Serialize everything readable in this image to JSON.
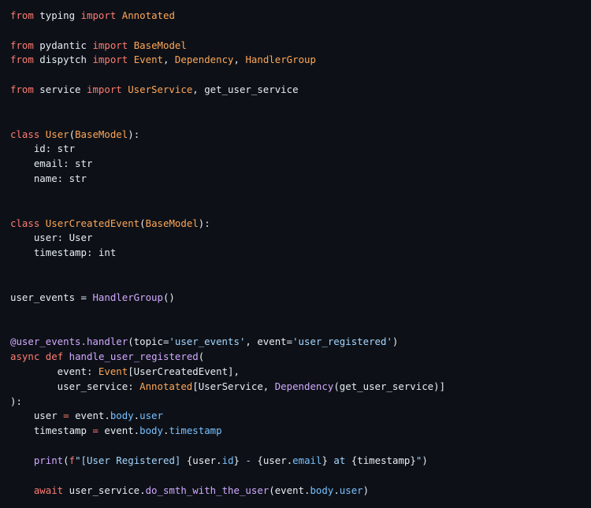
{
  "editor": {
    "language": "python",
    "theme_colors": {
      "background": "#0d1117",
      "text": "#e6edf3",
      "keyword": "#ff7b72",
      "class_name": "#ffa657",
      "function_name": "#d2a8ff",
      "string": "#a5d6ff",
      "attribute": "#79c0ff"
    },
    "lines": [
      [
        {
          "t": "kw",
          "v": "from"
        },
        {
          "t": "txt",
          "v": " typing "
        },
        {
          "t": "kw",
          "v": "import"
        },
        {
          "t": "txt",
          "v": " "
        },
        {
          "t": "cls",
          "v": "Annotated"
        }
      ],
      [],
      [
        {
          "t": "kw",
          "v": "from"
        },
        {
          "t": "txt",
          "v": " pydantic "
        },
        {
          "t": "kw",
          "v": "import"
        },
        {
          "t": "txt",
          "v": " "
        },
        {
          "t": "cls",
          "v": "BaseModel"
        }
      ],
      [
        {
          "t": "kw",
          "v": "from"
        },
        {
          "t": "txt",
          "v": " dispytch "
        },
        {
          "t": "kw",
          "v": "import"
        },
        {
          "t": "txt",
          "v": " "
        },
        {
          "t": "cls",
          "v": "Event"
        },
        {
          "t": "txt",
          "v": ", "
        },
        {
          "t": "cls",
          "v": "Dependency"
        },
        {
          "t": "txt",
          "v": ", "
        },
        {
          "t": "cls",
          "v": "HandlerGroup"
        }
      ],
      [],
      [
        {
          "t": "kw",
          "v": "from"
        },
        {
          "t": "txt",
          "v": " service "
        },
        {
          "t": "kw",
          "v": "import"
        },
        {
          "t": "txt",
          "v": " "
        },
        {
          "t": "cls",
          "v": "UserService"
        },
        {
          "t": "txt",
          "v": ", get_user_service"
        }
      ],
      [],
      [],
      [
        {
          "t": "kw",
          "v": "class"
        },
        {
          "t": "txt",
          "v": " "
        },
        {
          "t": "cls",
          "v": "User"
        },
        {
          "t": "txt",
          "v": "("
        },
        {
          "t": "cls",
          "v": "BaseModel"
        },
        {
          "t": "txt",
          "v": "):"
        }
      ],
      [
        {
          "t": "txt",
          "v": "    id: str"
        }
      ],
      [
        {
          "t": "txt",
          "v": "    email: str"
        }
      ],
      [
        {
          "t": "txt",
          "v": "    name: str"
        }
      ],
      [],
      [],
      [
        {
          "t": "kw",
          "v": "class"
        },
        {
          "t": "txt",
          "v": " "
        },
        {
          "t": "cls",
          "v": "UserCreatedEvent"
        },
        {
          "t": "txt",
          "v": "("
        },
        {
          "t": "cls",
          "v": "BaseModel"
        },
        {
          "t": "txt",
          "v": "):"
        }
      ],
      [
        {
          "t": "txt",
          "v": "    user: User"
        }
      ],
      [
        {
          "t": "txt",
          "v": "    timestamp: int"
        }
      ],
      [],
      [],
      [
        {
          "t": "txt",
          "v": "user_events = "
        },
        {
          "t": "fn",
          "v": "HandlerGroup"
        },
        {
          "t": "txt",
          "v": "()"
        }
      ],
      [],
      [],
      [
        {
          "t": "fn",
          "v": "@user_events.handler"
        },
        {
          "t": "txt",
          "v": "(topic="
        },
        {
          "t": "str",
          "v": "'user_events'"
        },
        {
          "t": "txt",
          "v": ", event="
        },
        {
          "t": "str",
          "v": "'user_registered'"
        },
        {
          "t": "txt",
          "v": ")"
        }
      ],
      [
        {
          "t": "kw",
          "v": "async"
        },
        {
          "t": "txt",
          "v": " "
        },
        {
          "t": "kw",
          "v": "def"
        },
        {
          "t": "txt",
          "v": " "
        },
        {
          "t": "fn",
          "v": "handle_user_registered"
        },
        {
          "t": "txt",
          "v": "("
        }
      ],
      [
        {
          "t": "txt",
          "v": "        event: "
        },
        {
          "t": "cls",
          "v": "Event"
        },
        {
          "t": "txt",
          "v": "[UserCreatedEvent],"
        }
      ],
      [
        {
          "t": "txt",
          "v": "        user_service: "
        },
        {
          "t": "cls",
          "v": "Annotated"
        },
        {
          "t": "txt",
          "v": "[UserService, "
        },
        {
          "t": "fn",
          "v": "Dependency"
        },
        {
          "t": "txt",
          "v": "(get_user_service)]"
        }
      ],
      [
        {
          "t": "txt",
          "v": "):"
        }
      ],
      [
        {
          "t": "txt",
          "v": "    user "
        },
        {
          "t": "kw",
          "v": "="
        },
        {
          "t": "txt",
          "v": " event."
        },
        {
          "t": "attr",
          "v": "body"
        },
        {
          "t": "txt",
          "v": "."
        },
        {
          "t": "attr",
          "v": "user"
        }
      ],
      [
        {
          "t": "txt",
          "v": "    timestamp "
        },
        {
          "t": "kw",
          "v": "="
        },
        {
          "t": "txt",
          "v": " event."
        },
        {
          "t": "attr",
          "v": "body"
        },
        {
          "t": "txt",
          "v": "."
        },
        {
          "t": "attr",
          "v": "timestamp"
        }
      ],
      [],
      [
        {
          "t": "txt",
          "v": "    "
        },
        {
          "t": "fn",
          "v": "print"
        },
        {
          "t": "txt",
          "v": "("
        },
        {
          "t": "kw",
          "v": "f"
        },
        {
          "t": "str",
          "v": "\"[User Registered] "
        },
        {
          "t": "txt",
          "v": "{user."
        },
        {
          "t": "attr",
          "v": "id"
        },
        {
          "t": "txt",
          "v": "}"
        },
        {
          "t": "str",
          "v": " - "
        },
        {
          "t": "txt",
          "v": "{user."
        },
        {
          "t": "attr",
          "v": "email"
        },
        {
          "t": "txt",
          "v": "}"
        },
        {
          "t": "str",
          "v": " at "
        },
        {
          "t": "txt",
          "v": "{timestamp}"
        },
        {
          "t": "str",
          "v": "\""
        },
        {
          "t": "txt",
          "v": ")"
        }
      ],
      [],
      [
        {
          "t": "txt",
          "v": "    "
        },
        {
          "t": "kw",
          "v": "await"
        },
        {
          "t": "txt",
          "v": " user_service."
        },
        {
          "t": "fn",
          "v": "do_smth_with_the_user"
        },
        {
          "t": "txt",
          "v": "(event."
        },
        {
          "t": "attr",
          "v": "body"
        },
        {
          "t": "txt",
          "v": "."
        },
        {
          "t": "attr",
          "v": "user"
        },
        {
          "t": "txt",
          "v": ")"
        }
      ]
    ]
  }
}
